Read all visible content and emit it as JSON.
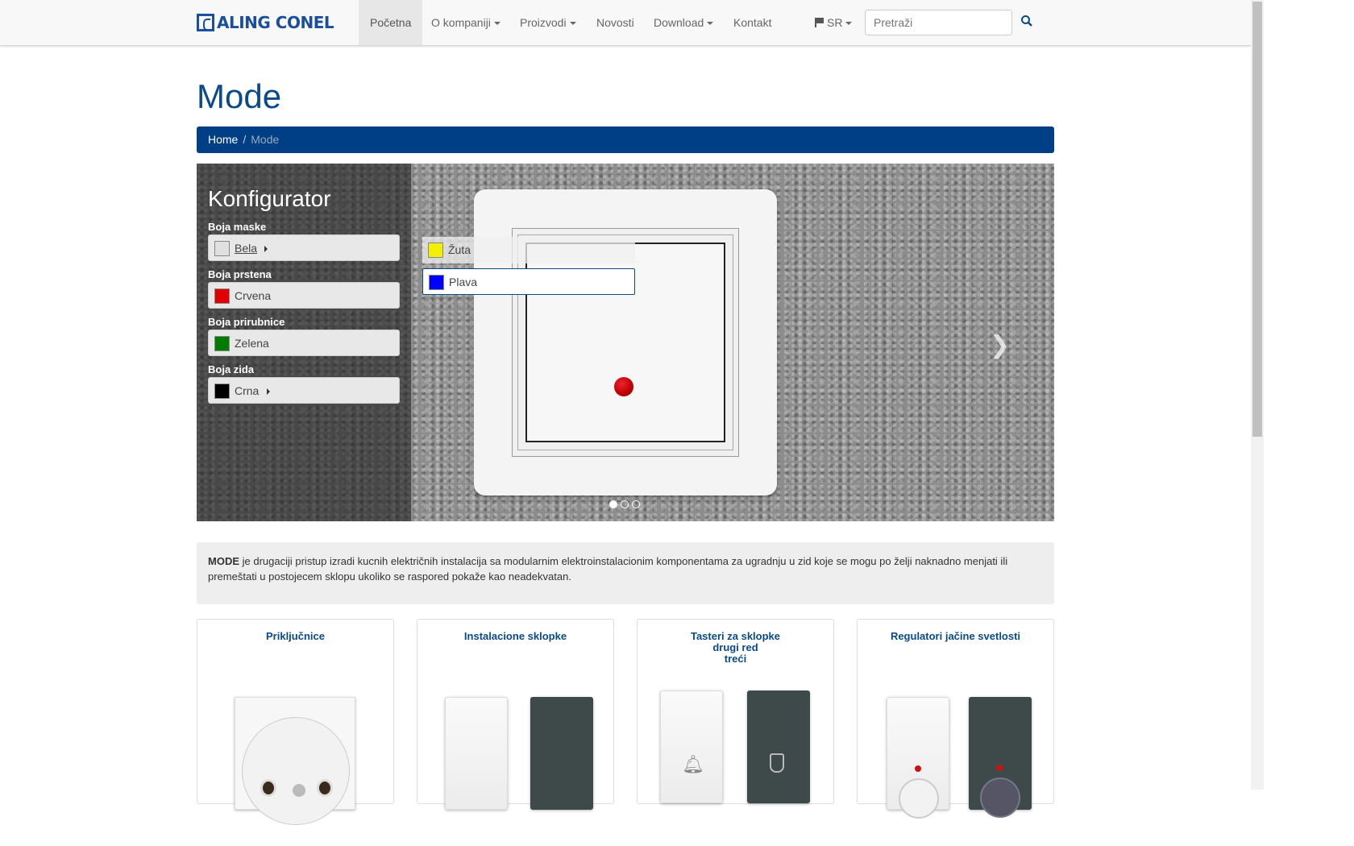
{
  "brand": {
    "name": "ALING CONEL"
  },
  "nav": {
    "items": [
      "Početna",
      "O kompaniji",
      "Proizvodi",
      "Novosti",
      "Download",
      "Kontakt"
    ],
    "lang": "SR",
    "search_placeholder": "Pretraži"
  },
  "page": {
    "title": "Mode"
  },
  "breadcrumb": {
    "home": "Home",
    "separator": "/",
    "current": "Mode"
  },
  "configurator": {
    "title": "Konfigurator",
    "options": [
      {
        "label": "Boja maske",
        "value": "Bela",
        "color": "#e0e0e0"
      },
      {
        "label": "Boja prstena",
        "value": "Crvena",
        "color": "#e00000"
      },
      {
        "label": "Boja prirubnice",
        "value": "Zelena",
        "color": "#007a00"
      },
      {
        "label": "Boja zida",
        "value": "Crna",
        "color": "#000000"
      }
    ],
    "dropdown": [
      {
        "label": "Žuta",
        "color": "#f2f000"
      },
      {
        "label": "Plava",
        "color": "#0000ff"
      }
    ]
  },
  "intro": {
    "bold": "MODE",
    "text": " je drugaciji pristup izradi kucnih električnih instalacija sa modularnim elektroinstalacionim komponentama za ugradnju u zid koje se mogu po želji naknadno menjati ili premeštati u postojecem sklopu ukoliko se raspored pokaže kao neadekvatan."
  },
  "cards": [
    {
      "title": "Priključnice"
    },
    {
      "title": "Instalacione sklopke"
    },
    {
      "title": "Tasteri za sklopke\ndrugi red\ntreći"
    },
    {
      "title": "Regulatori jačine svetlosti"
    }
  ],
  "colors": {
    "brand": "#0a4a89",
    "breadcrumb_bg": "#003f86"
  }
}
